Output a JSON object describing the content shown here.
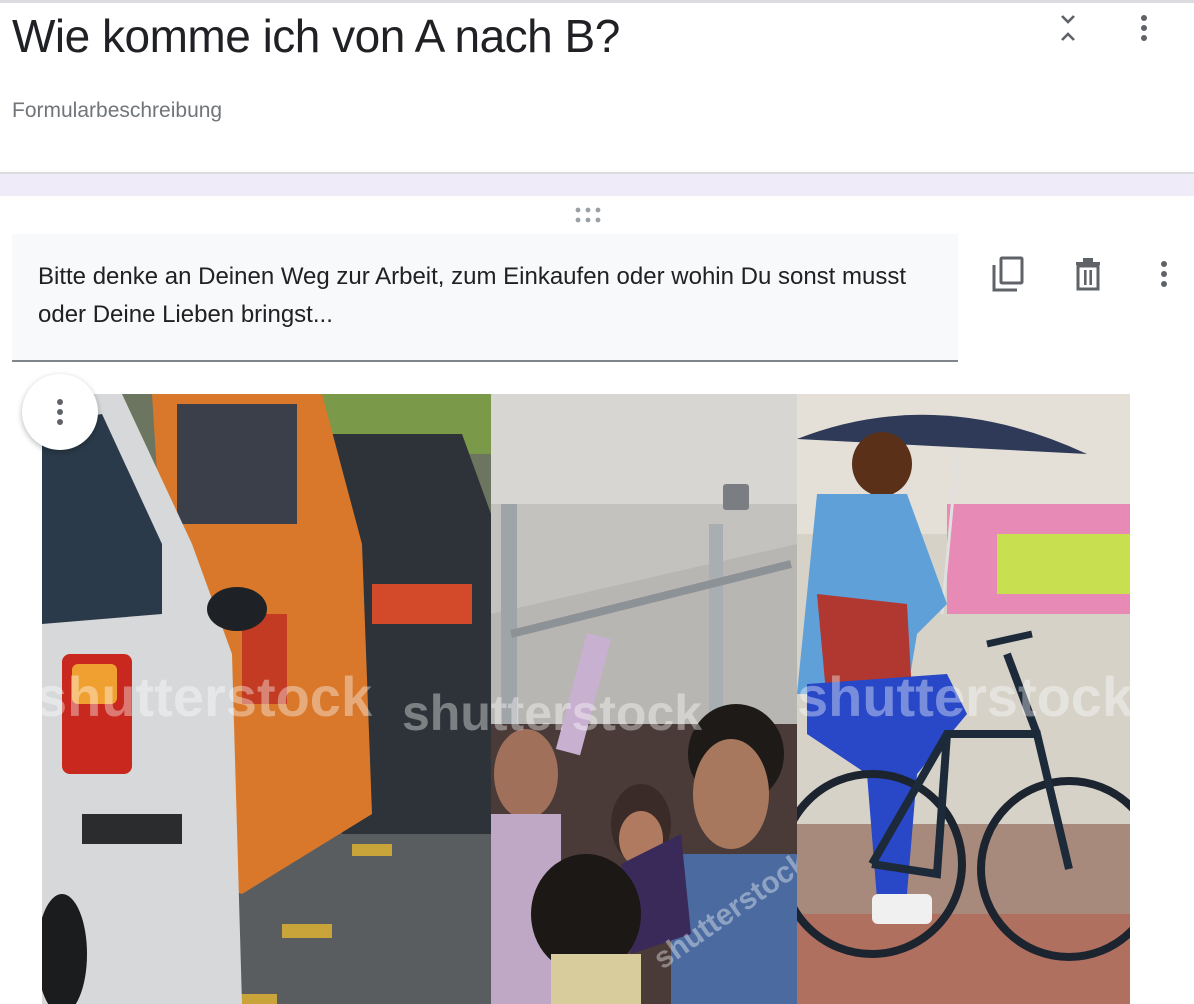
{
  "form": {
    "title": "Wie komme ich von A nach B?",
    "description_placeholder": "Formularbeschreibung"
  },
  "header_icons": {
    "collapse": "unfold-less-icon",
    "more": "more-vert-icon"
  },
  "text_item": {
    "text": "Bitte denke an Deinen Weg zur Arbeit, zum Einkaufen oder wohin Du sonst musst oder Deine Lieben bringst...",
    "icons": [
      "drag-handle-icon",
      "copy-icon",
      "delete-icon",
      "more-vert-icon"
    ]
  },
  "image": {
    "panels": [
      "traffic-jam-cars",
      "crowded-subway",
      "cyclist-with-umbrella"
    ],
    "watermarks": [
      "shutterstock",
      "shutterstock",
      "shutterstock",
      "shutterstock"
    ],
    "menu_icon": "more-vert-icon"
  },
  "colors": {
    "section_gap": "#f0ebf8",
    "text_field_bg": "#f8f9fa",
    "icon_gray": "#5f6368"
  }
}
